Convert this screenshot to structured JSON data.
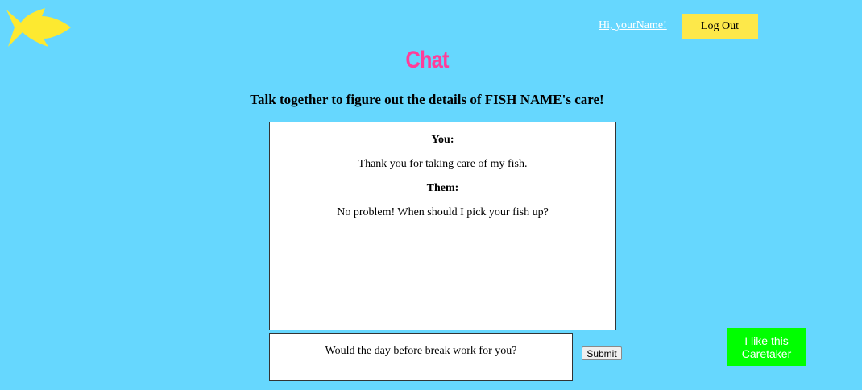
{
  "header": {
    "logo_icon": "fish-icon",
    "logo_color": "#fde930",
    "greeting": "Hi, yourName!",
    "logout_label": "Log Out"
  },
  "page": {
    "title": "Chat",
    "subtitle": "Talk together to figure out the details of FISH NAME's care!"
  },
  "chat": {
    "messages": [
      {
        "sender": "You:",
        "text": "Thank you for taking care of my fish."
      },
      {
        "sender": "Them:",
        "text": "No problem! When should I pick your fish up?"
      }
    ],
    "input_value": "Would the day before break work for you?",
    "submit_label": "Submit"
  },
  "actions": {
    "like_label": "I like this Caretaker"
  },
  "colors": {
    "background": "#66d7fe",
    "title": "#ff3d9a",
    "logout_button": "#fde84a",
    "like_button": "#00ff00"
  }
}
